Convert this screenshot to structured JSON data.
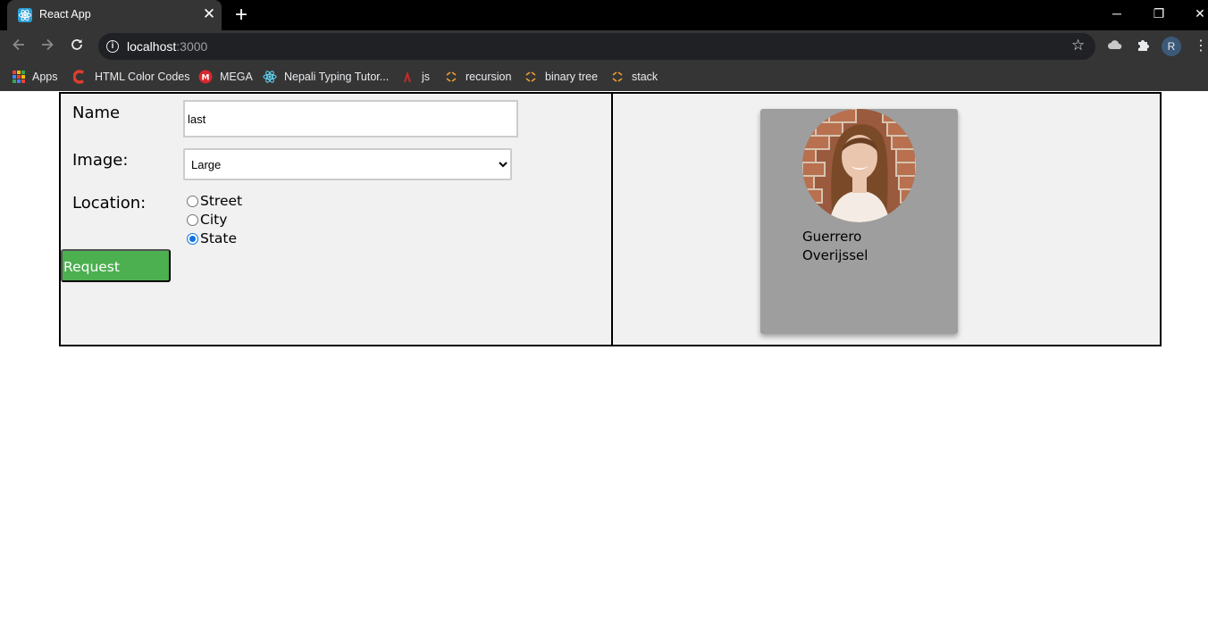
{
  "browser": {
    "tab_title": "React App",
    "tab_close": "✕",
    "new_tab": "+",
    "url_host": "localhost",
    "url_port": ":3000",
    "profile_initial": "R",
    "window_controls": {
      "minimize": "─",
      "restore": "❐",
      "close": "✕"
    },
    "bookmarks": [
      {
        "label": "Apps",
        "icon": "apps-grid-icon"
      },
      {
        "label": "HTML Color Codes",
        "icon": "html-color-codes-icon",
        "color": "#e03e2d"
      },
      {
        "label": "MEGA",
        "icon": "mega-icon",
        "color": "#d9272e"
      },
      {
        "label": "Nepali Typing Tutor...",
        "icon": "react-icon",
        "color": "#61dafb"
      },
      {
        "label": "js",
        "icon": "js-icon",
        "color": "#c92a2a"
      },
      {
        "label": "recursion",
        "icon": "code-icon",
        "color": "#f0a030"
      },
      {
        "label": "binary tree",
        "icon": "code-icon",
        "color": "#f0a030"
      },
      {
        "label": "stack",
        "icon": "code-icon",
        "color": "#f0a030"
      }
    ]
  },
  "form": {
    "name_label": "Name",
    "name_value": "last",
    "image_label": "Image:",
    "image_selected": "Large",
    "location_label": "Location:",
    "location_options": [
      "Street",
      "City",
      "State"
    ],
    "location_selected": "State",
    "request_label": "Request",
    "request_color": "#4caf50"
  },
  "card": {
    "photo": "profile-photo",
    "line1": "Guerrero",
    "line2": "Overijssel"
  }
}
